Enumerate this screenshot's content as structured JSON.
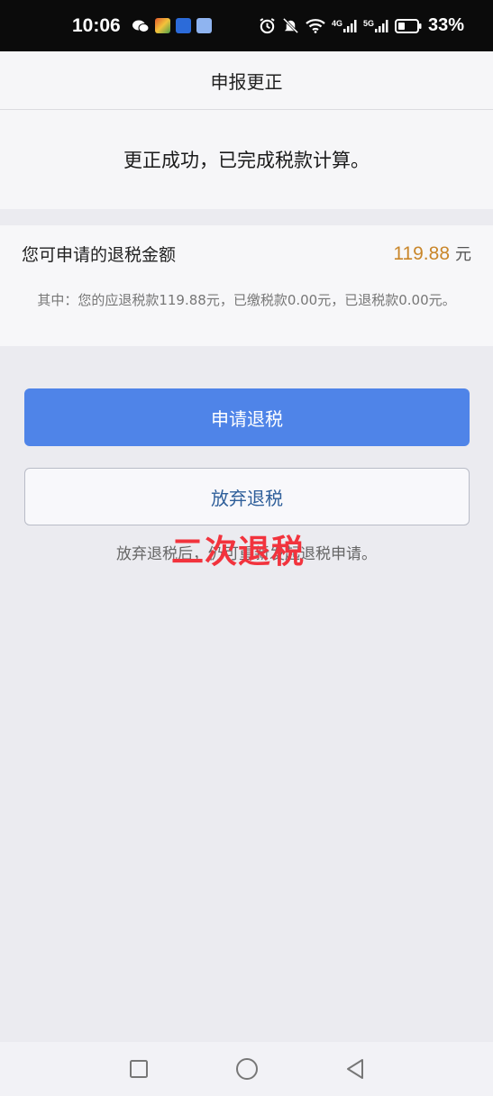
{
  "status_bar": {
    "time": "10:06",
    "app_icons": [
      "wechat-icon",
      "game-app-icon",
      "blue-app-icon",
      "music-app-icon"
    ],
    "net_a": "4G",
    "net_b": "5G",
    "battery": "33%"
  },
  "header": {
    "title": "申报更正"
  },
  "success": {
    "message": "更正成功，已完成税款计算。"
  },
  "refund": {
    "label": "您可申请的退税金额",
    "amount": "119.88",
    "unit": "元",
    "detail": "其中：您的应退税款119.88元，已缴税款0.00元，已退税款0.00元。"
  },
  "actions": {
    "apply_label": "申请退税",
    "abandon_label": "放弃退税",
    "note": "放弃退税后，仍可重新发起退税申请。"
  },
  "overlay": {
    "text": "二次退税",
    "color": "#f2333d"
  },
  "colors": {
    "accent": "#4f84e8",
    "amount": "#c9862a"
  }
}
